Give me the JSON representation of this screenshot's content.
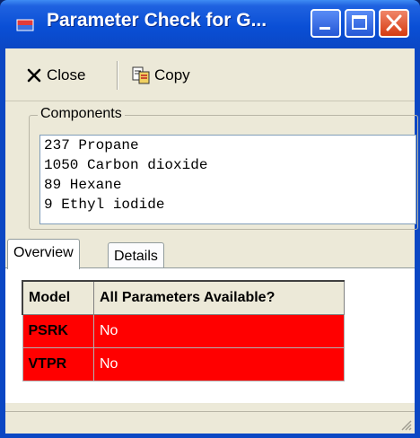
{
  "titlebar": {
    "title": "Parameter Check for G...",
    "minimize_icon": "minimize-icon",
    "maximize_icon": "maximize-icon",
    "close_icon": "close-icon"
  },
  "toolbar": {
    "close_label": "Close",
    "copy_label": "Copy"
  },
  "components": {
    "label": "Components",
    "items": [
      "237 Propane",
      "1050 Carbon dioxide",
      "89 Hexane",
      "9 Ethyl iodide"
    ]
  },
  "tabs": [
    {
      "label": "Overview",
      "active": true
    },
    {
      "label": "Details",
      "active": false
    }
  ],
  "table": {
    "headers": [
      "Model",
      "All Parameters Available?"
    ],
    "rows": [
      {
        "model": "PSRK",
        "available": "No"
      },
      {
        "model": "VTPR",
        "available": "No"
      }
    ]
  },
  "colors": {
    "titlebar": "#0a4fd6",
    "row_highlight": "#ff0000",
    "window_bg": "#ece9d8"
  }
}
